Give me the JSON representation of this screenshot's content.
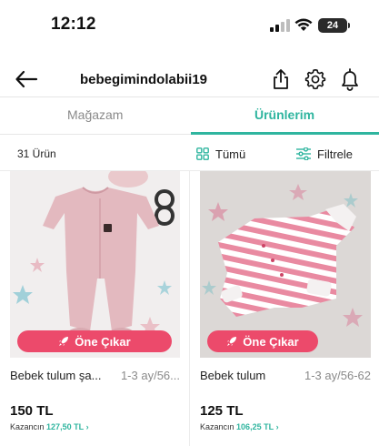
{
  "status_bar": {
    "time": "12:12",
    "battery": "24"
  },
  "header": {
    "title": "bebegimindolabii19"
  },
  "tabs": [
    {
      "label": "Mağazam",
      "active": false
    },
    {
      "label": "Ürünlerim",
      "active": true
    }
  ],
  "filter_bar": {
    "count": "31 Ürün",
    "all_label": "Tümü",
    "filter_label": "Filtrele"
  },
  "products": [
    {
      "title": "Bebek tulum şa...",
      "size": "1-3 ay/56...",
      "promote_label": "Öne Çıkar",
      "price": "150 TL",
      "earning_label": "Kazancın",
      "earning_value": "127,50 TL"
    },
    {
      "title": "Bebek tulum",
      "size": "1-3 ay/56-62",
      "promote_label": "Öne Çıkar",
      "price": "125 TL",
      "earning_label": "Kazancın",
      "earning_value": "106,25 TL"
    }
  ],
  "colors": {
    "accent": "#2fb59f",
    "promote": "#ec4a6b"
  }
}
